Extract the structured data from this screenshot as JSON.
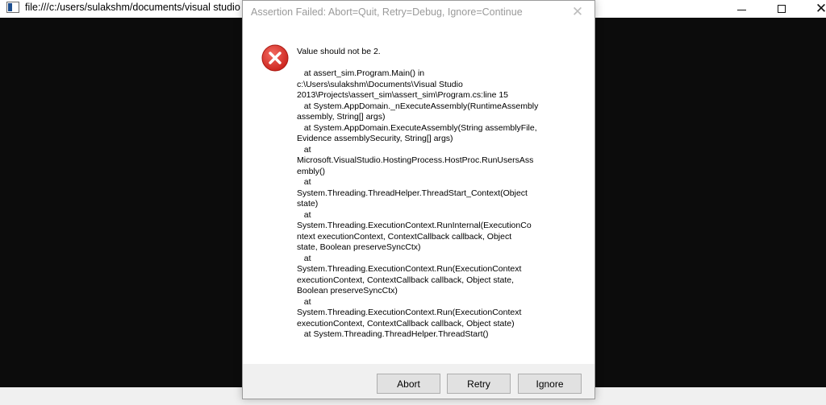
{
  "console_window": {
    "title": "file:///c:/users/sulakshm/documents/visual studio",
    "app_icon": "console-app-icon",
    "minimize_icon": "minimize-icon",
    "maximize_icon": "maximize-icon",
    "close_icon": "close-icon",
    "close_glyph": "✕",
    "body_color": "#0c0c0c"
  },
  "dialog": {
    "title": "Assertion Failed: Abort=Quit, Retry=Debug, Ignore=Continue",
    "close_glyph": "✕",
    "icon": "error-icon",
    "icon_color": "#e0332e",
    "message": "Value should not be 2.\n\n   at assert_sim.Program.Main() in\nc:\\Users\\sulakshm\\Documents\\Visual Studio\n2013\\Projects\\assert_sim\\assert_sim\\Program.cs:line 15\n   at System.AppDomain._nExecuteAssembly(RuntimeAssembly\nassembly, String[] args)\n   at System.AppDomain.ExecuteAssembly(String assemblyFile,\nEvidence assemblySecurity, String[] args)\n   at\nMicrosoft.VisualStudio.HostingProcess.HostProc.RunUsersAss\nembly()\n   at\nSystem.Threading.ThreadHelper.ThreadStart_Context(Object\nstate)\n   at\nSystem.Threading.ExecutionContext.RunInternal(ExecutionCo\nntext executionContext, ContextCallback callback, Object\nstate, Boolean preserveSyncCtx)\n   at\nSystem.Threading.ExecutionContext.Run(ExecutionContext\nexecutionContext, ContextCallback callback, Object state,\nBoolean preserveSyncCtx)\n   at\nSystem.Threading.ExecutionContext.Run(ExecutionContext\nexecutionContext, ContextCallback callback, Object state)\n   at System.Threading.ThreadHelper.ThreadStart()",
    "buttons": {
      "abort": "Abort",
      "retry": "Retry",
      "ignore": "Ignore"
    }
  }
}
